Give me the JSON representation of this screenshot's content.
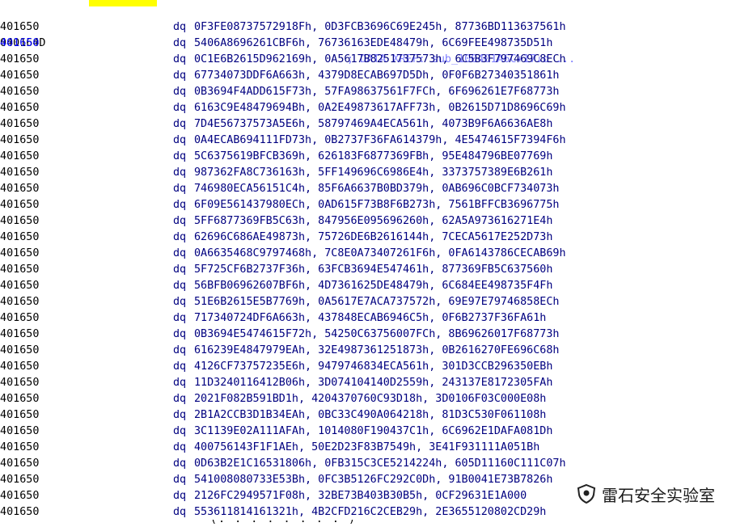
{
  "header_row": {
    "address": "0040164D",
    "comment": "; DATA XREF: sub_100401A6C+17↓o ..."
  },
  "mnemonic": "dq",
  "current_address": "0401650",
  "rows": [
    {
      "address": "0401650",
      "operands": "0F3FE08737572918Fh, 0D3FCB3696C69E245h, 87736BD113637561h"
    },
    {
      "address": "0401650",
      "operands": "5406A8696261CBF6h, 76736163EDE48479h, 6C69FEE498735D51h"
    },
    {
      "address": "0401650",
      "operands": "0C1E6B2615D962169h, 0A5617B8251737573h, 6C5B3F797469C8ECh"
    },
    {
      "address": "0401650",
      "operands": "67734073DDF6A663h, 4379D8ECAB697D5Dh, 0F0F6B27340351861h"
    },
    {
      "address": "0401650",
      "operands": "0B3694F4ADD615F73h, 57FA98637561F7FCh, 6F696261E7F68773h"
    },
    {
      "address": "0401650",
      "operands": "6163C9E48479694Bh, 0A2E49873617AFF73h, 0B2615D71D8696C69h"
    },
    {
      "address": "0401650",
      "operands": "7D4E56737573A5E6h, 58797469A4ECA561h, 4073B9F6A6636AE8h"
    },
    {
      "address": "0401650",
      "operands": "0A4ECAB694111FD73h, 0B2737F36FA614379h, 4E5474615F7394F6h"
    },
    {
      "address": "0401650",
      "operands": "5C6375619BFCB369h, 626183F6877369FBh, 95E484796BE07769h"
    },
    {
      "address": "0401650",
      "operands": "987362FA8C736163h, 5FF149696C6986E4h, 3373757389E6B261h"
    },
    {
      "address": "0401650",
      "operands": "746980ECA56151C4h, 85F6A6637B0BD379h, 0AB696C0BCF734073h"
    },
    {
      "address": "0401650",
      "operands": "6F09E561437980ECh, 0AD615F73B8F6B273h, 7561BFFCB3696775h"
    },
    {
      "address": "0401650",
      "operands": "5FF6877369FB5C63h, 847956E095696260h, 62A5A973616271E4h"
    },
    {
      "address": "0401650",
      "operands": "62696C686AE49873h, 75726DE6B2616144h, 7CECA5617E252D73h"
    },
    {
      "address": "0401650",
      "operands": "0A6635468C9797468h, 7C8E0A73407261F6h, 0FA6143786CECAB69h"
    },
    {
      "address": "0401650",
      "operands": "5F725CF6B2737F36h, 63FCB3694E547461h, 877369FB5C637560h"
    },
    {
      "address": "0401650",
      "operands": "56BFB06962607BF6h, 4D7361625DE48479h, 6C684EE498735F4Fh"
    },
    {
      "address": "0401650",
      "operands": "51E6B2615E5B7769h, 0A5617E7ACA737572h, 69E97E79746858ECh"
    },
    {
      "address": "0401650",
      "operands": "717340724DF6A663h, 437848ECAB6946C5h, 0F6B2737F36FA61h"
    },
    {
      "address": "0401650",
      "operands": "0B3694E5474615F72h, 54250C63756007FCh, 8B69626017F68773h"
    },
    {
      "address": "0401650",
      "operands": "616239E4847979EAh, 32E4987361251873h, 0B2616270FE696C68h"
    },
    {
      "address": "0401650",
      "operands": "4126CF73757235E6h, 9479746834ECA561h, 301D3CCB296350EBh"
    },
    {
      "address": "0401650",
      "operands": "11D3240116412B06h, 3D074104140D2559h, 243137E8172305FAh"
    },
    {
      "address": "0401650",
      "operands": "2021F082B591BD1h, 4204370760C93D18h, 3D0106F03C000E08h"
    },
    {
      "address": "0401650",
      "operands": "2B1A2CCB3D1B34EAh, 0BC33C490A064218h, 81D3C530F061108h"
    },
    {
      "address": "0401650",
      "operands": "3C1139E02A111AFAh, 1014080F190437C1h, 6C6962E1DAFA081Dh"
    },
    {
      "address": "0401650",
      "operands": "400756143F1F1AEh, 50E2D23F83B7549h, 3E41F931111A051Bh"
    },
    {
      "address": "0401650",
      "operands": "0D63B2E1C16531806h, 0FB315C3CE5214224h, 605D11160C111C07h"
    },
    {
      "address": "0401650",
      "operands": "541008080733E53Bh, 0FC3B5126FC292C0Dh, 91B0041E73B7826h"
    },
    {
      "address": "0401650",
      "operands": "2126FC2949571F08h, 32BE73B403B30B5h, 0CF29631E1A000"
    },
    {
      "address": "0401650",
      "operands": "553611814161321h, 4B2CFD216C2CEB29h, 2E3655120802CD29h"
    }
  ],
  "footer_partial": "(.  .  .  .  .  .  .  .  )",
  "watermark": {
    "text": "雷石安全实验室",
    "logo_icon": "shield-logo-icon"
  }
}
